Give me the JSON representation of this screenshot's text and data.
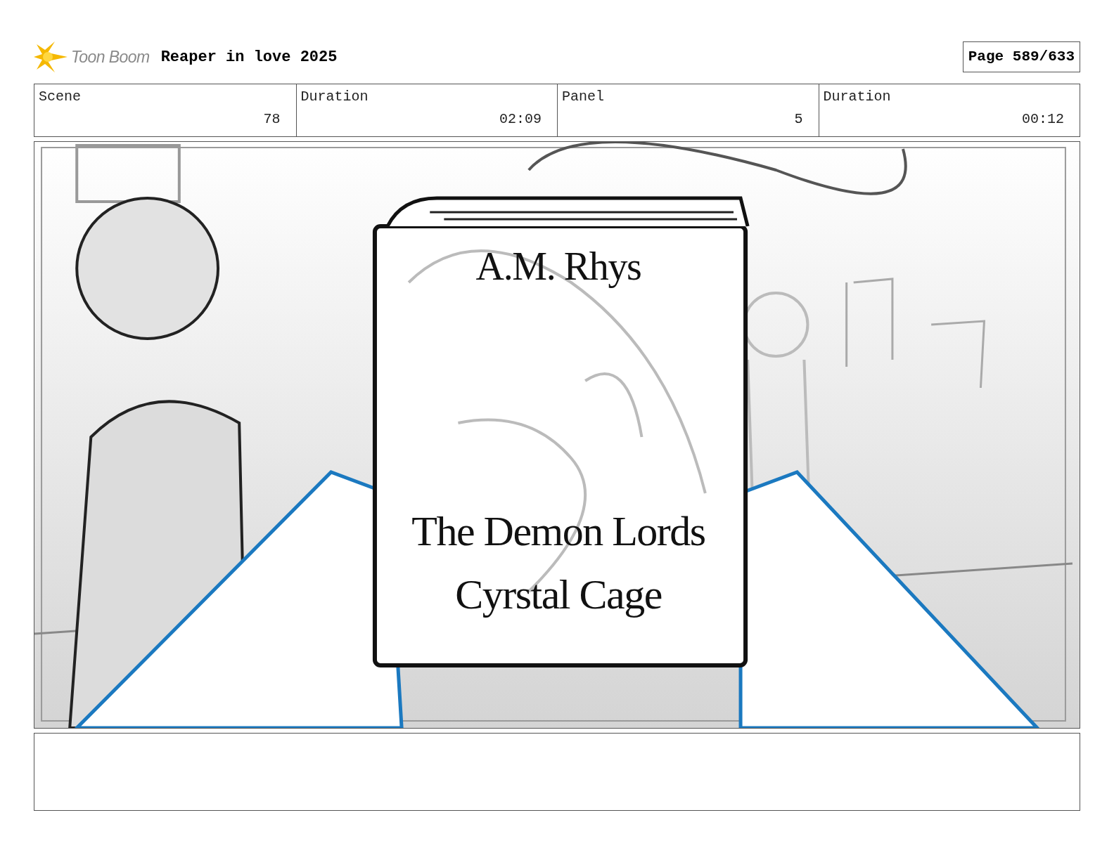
{
  "header": {
    "logo_text": "Toon Boom",
    "project_title": "Reaper in love 2025",
    "page": "Page 589/633"
  },
  "info": [
    {
      "label": "Scene",
      "value": "78"
    },
    {
      "label": "Duration",
      "value": "02:09"
    },
    {
      "label": "Panel",
      "value": "5"
    },
    {
      "label": "Duration",
      "value": "00:12"
    }
  ],
  "panel": {
    "book": {
      "author": "A.M. Rhys",
      "title_lines": [
        "The Demon Lords",
        "Cyrstal Cage"
      ]
    }
  }
}
